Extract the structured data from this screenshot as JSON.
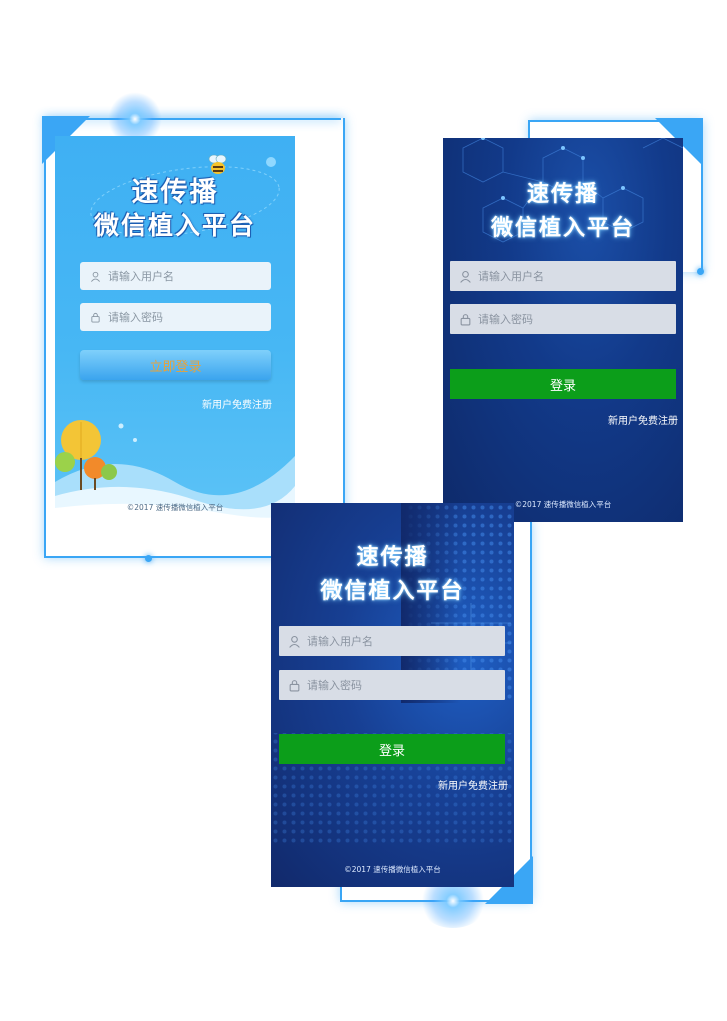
{
  "app_title": "速传播",
  "app_subtitle": "微信植入平台",
  "username_placeholder": "请输入用户名",
  "password_placeholder": "请输入密码",
  "login_label_light": "立即登录",
  "login_label_dark": "登录",
  "register_link": "新用户免费注册",
  "footer": "©2017 速传播微信植入平台",
  "icons": {
    "user": "user-icon",
    "lock": "lock-icon"
  },
  "colors": {
    "accent_blue": "#3aa6f5",
    "login_green": "#0c9e1a",
    "light_bg": "#47b7f4",
    "dark_bg": "#123a8a"
  }
}
